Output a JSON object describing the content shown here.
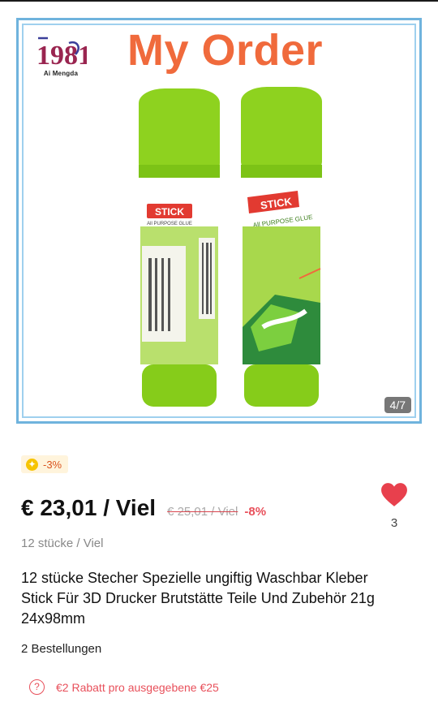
{
  "gallery": {
    "overlay_title": "My Order",
    "brand_logo_text": "1981",
    "brand_name": "Ai Mengda",
    "counter": "4/7",
    "image_subject": "two green glue sticks",
    "label_text": {
      "stick": "STICK",
      "all_purpose_small": "All PURPOSE GLUE",
      "all_purpose_big": "All PURPOSE GLUE"
    }
  },
  "coupon": {
    "icon": "coin-icon",
    "label": "-3%"
  },
  "price": {
    "current": "€ 23,01 / Viel",
    "original": "€ 25,01 / Viel",
    "discount": "-8%"
  },
  "wishlist": {
    "icon": "heart-icon",
    "count": "3"
  },
  "unit": "12 stücke / Viel",
  "title": "12 stücke Stecher Spezielle ungiftig Waschbar Kleber Stick Für 3D Drucker Brutstätte Teile Und Zubehör 21g 24x98mm",
  "orders": "2 Bestellungen",
  "promo": {
    "icon": "help-icon",
    "text": "€2 Rabatt pro ausgegebene €25"
  },
  "colors": {
    "accent_orange": "#f06a3c",
    "price_red": "#e8505b",
    "gallery_border": "#6fb3dd",
    "glue_green": "#8ed21f"
  }
}
